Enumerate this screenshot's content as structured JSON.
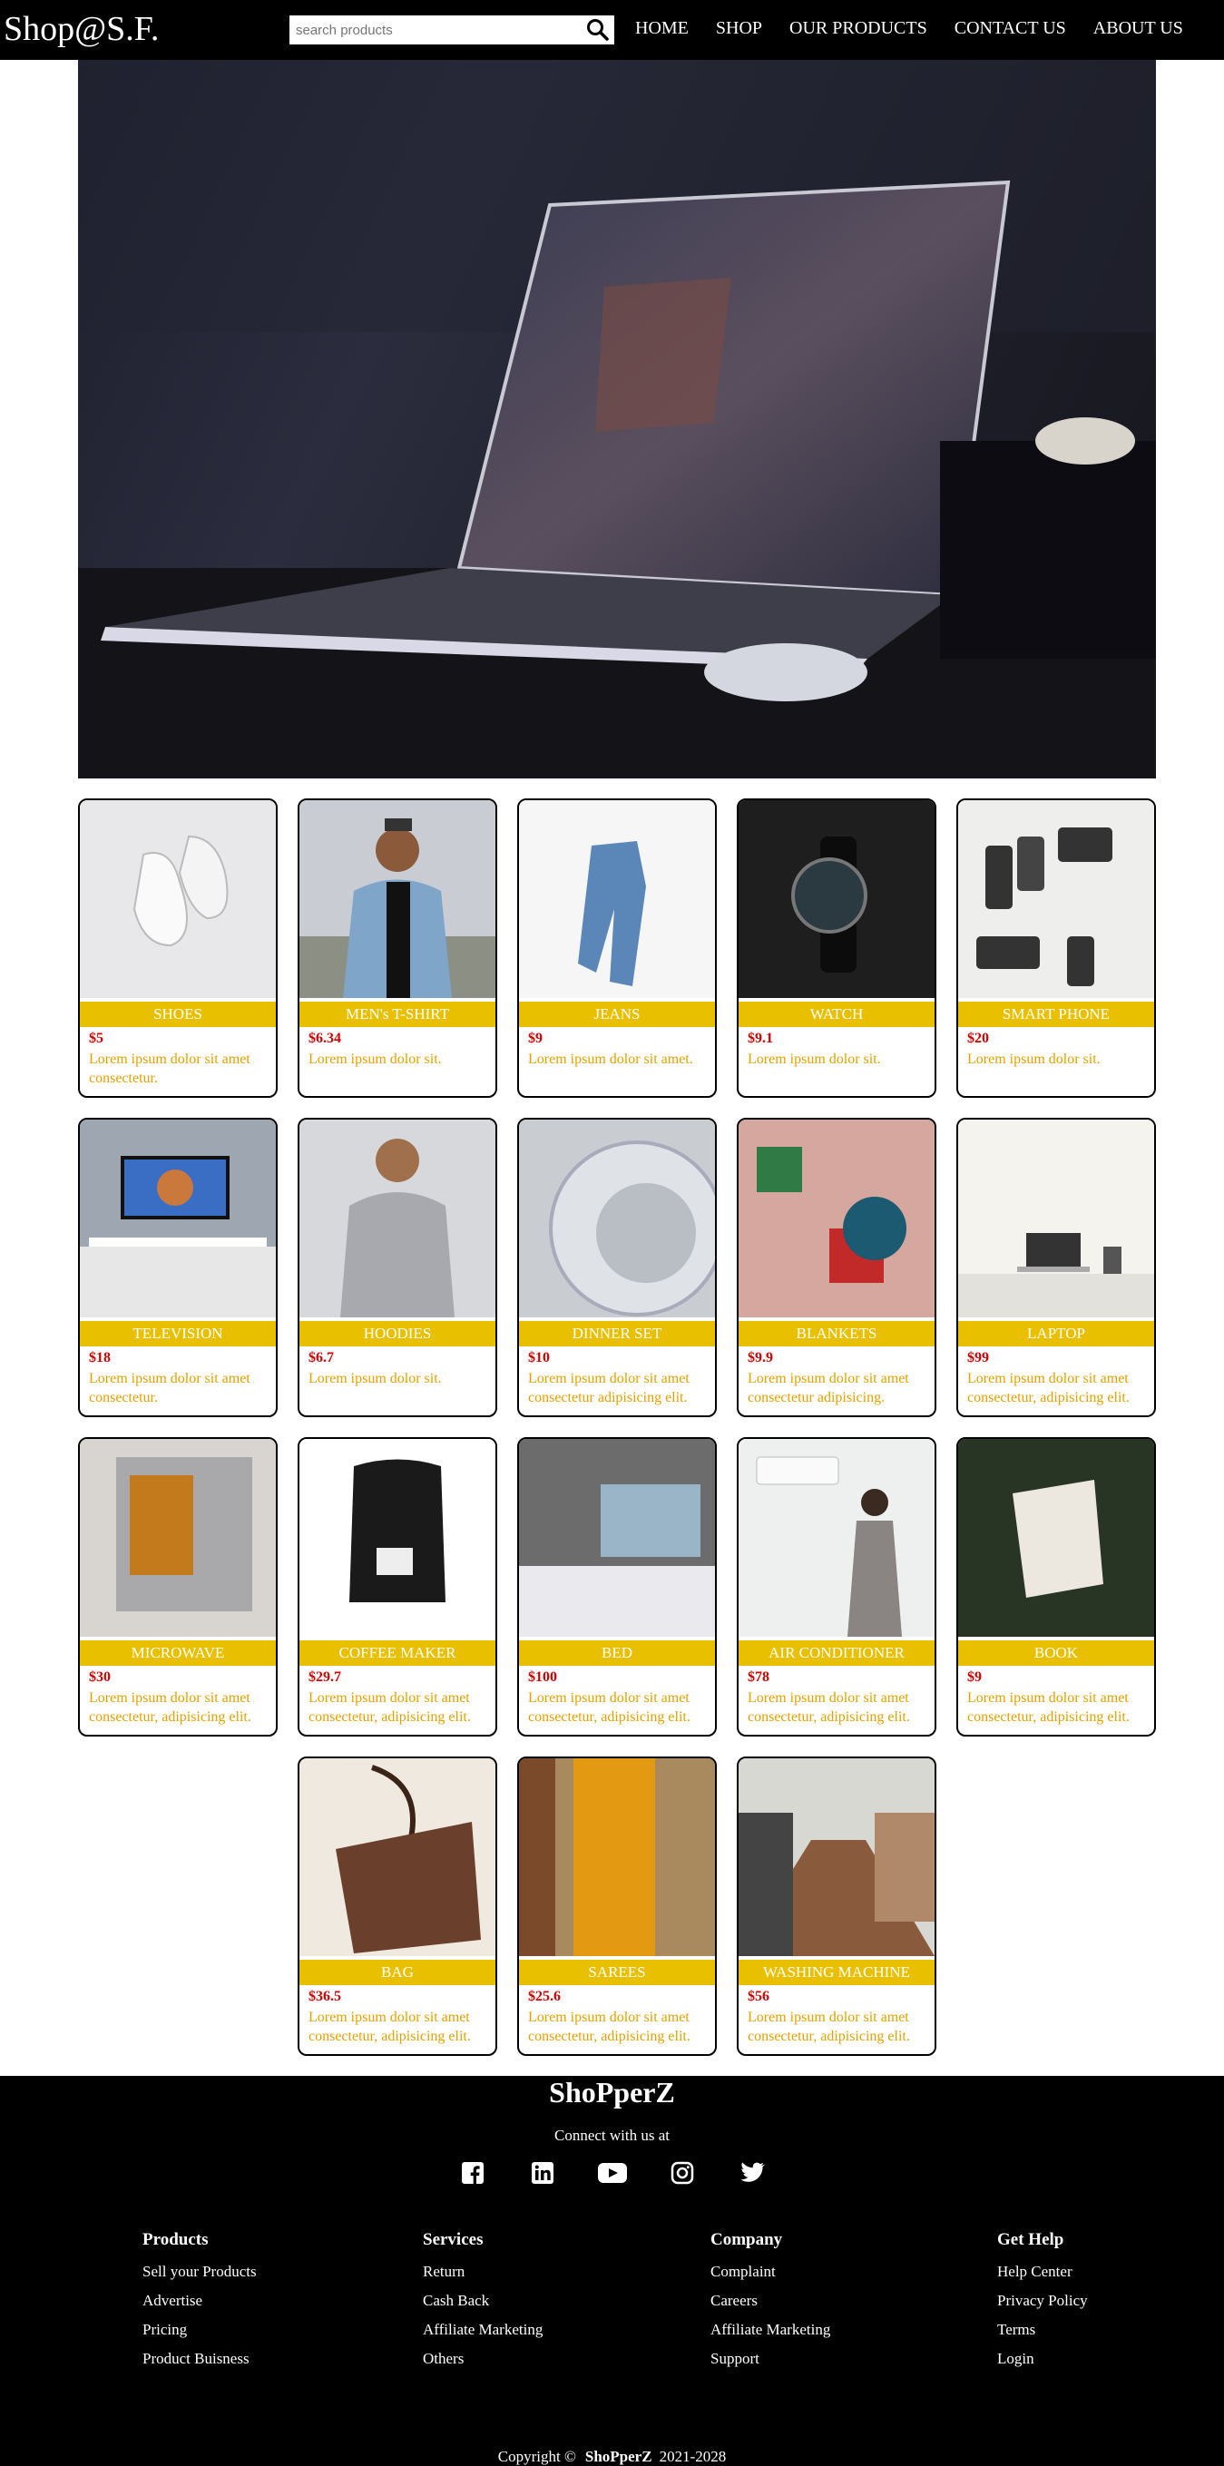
{
  "navbar": {
    "brand": "Shop@S.F.",
    "search_placeholder": "search products",
    "links": [
      "HOME",
      "SHOP",
      "OUR PRODUCTS",
      "CONTACT US",
      "ABOUT US"
    ]
  },
  "products": [
    {
      "name": "SHOES",
      "price": "$5",
      "desc": "Lorem ipsum dolor sit amet consectetur."
    },
    {
      "name": "MEN's T-SHIRT",
      "price": "$6.34",
      "desc": "Lorem ipsum dolor sit."
    },
    {
      "name": "JEANS",
      "price": "$9",
      "desc": "Lorem ipsum dolor sit amet."
    },
    {
      "name": "WATCH",
      "price": "$9.1",
      "desc": "Lorem ipsum dolor sit."
    },
    {
      "name": "SMART PHONE",
      "price": "$20",
      "desc": "Lorem ipsum dolor sit."
    },
    {
      "name": "TELEVISION",
      "price": "$18",
      "desc": "Lorem ipsum dolor sit amet consectetur."
    },
    {
      "name": "HOODIES",
      "price": "$6.7",
      "desc": "Lorem ipsum dolor sit."
    },
    {
      "name": "DINNER SET",
      "price": "$10",
      "desc": "Lorem ipsum dolor sit amet consectetur adipisicing elit."
    },
    {
      "name": "BLANKETS",
      "price": "$9.9",
      "desc": "Lorem ipsum dolor sit amet consectetur adipisicing."
    },
    {
      "name": "LAPTOP",
      "price": "$99",
      "desc": "Lorem ipsum dolor sit amet consectetur, adipisicing elit."
    },
    {
      "name": "MICROWAVE",
      "price": "$30",
      "desc": "Lorem ipsum dolor sit amet consectetur, adipisicing elit."
    },
    {
      "name": "COFFEE MAKER",
      "price": "$29.7",
      "desc": "Lorem ipsum dolor sit amet consectetur, adipisicing elit."
    },
    {
      "name": "BED",
      "price": "$100",
      "desc": "Lorem ipsum dolor sit amet consectetur, adipisicing elit."
    },
    {
      "name": "AIR CONDITIONER",
      "price": "$78",
      "desc": "Lorem ipsum dolor sit amet consectetur, adipisicing elit."
    },
    {
      "name": "BOOK",
      "price": "$9",
      "desc": "Lorem ipsum dolor sit amet consectetur, adipisicing elit."
    },
    {
      "name": "BAG",
      "price": "$36.5",
      "desc": "Lorem ipsum dolor sit amet consectetur, adipisicing elit."
    },
    {
      "name": "SAREES",
      "price": "$25.6",
      "desc": "Lorem ipsum dolor sit amet consectetur, adipisicing elit."
    },
    {
      "name": "WASHING MACHINE",
      "price": "$56",
      "desc": "Lorem ipsum dolor sit amet consectetur, adipisicing elit."
    }
  ],
  "footer": {
    "title": "ShoPperZ",
    "connect": "Connect with us at",
    "social": [
      "facebook-icon",
      "linkedin-icon",
      "youtube-icon",
      "instagram-icon",
      "twitter-icon"
    ],
    "columns": [
      {
        "heading": "Products",
        "links": [
          "Sell your Products",
          "Advertise",
          "Pricing",
          "Product Buisness"
        ]
      },
      {
        "heading": "Services",
        "links": [
          "Return",
          "Cash Back",
          "Affiliate Marketing",
          "Others"
        ]
      },
      {
        "heading": "Company",
        "links": [
          "Complaint",
          "Careers",
          "Affiliate Marketing",
          "Support"
        ]
      },
      {
        "heading": "Get Help",
        "links": [
          "Help Center",
          "Privacy Policy",
          "Terms",
          "Login"
        ]
      }
    ],
    "copyright_prefix": "Copyright ©",
    "copyright_brand": "ShoPperZ",
    "copyright_years": "2021-2028"
  },
  "colors": {
    "navbar_bg": "#000000",
    "name_band": "#e9c000",
    "price": "#d10000",
    "desc": "#e3a100"
  }
}
